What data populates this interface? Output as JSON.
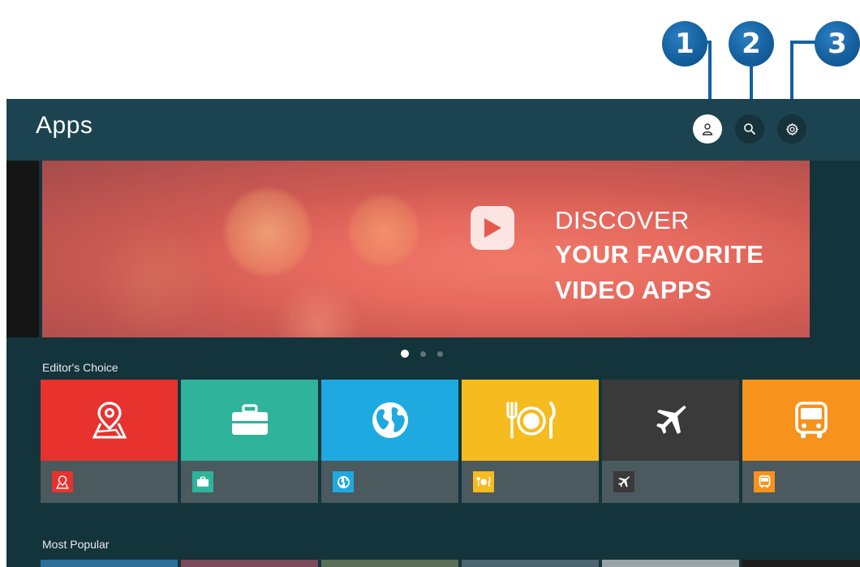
{
  "callouts": [
    "1",
    "2",
    "3"
  ],
  "header": {
    "title": "Apps",
    "buttons": [
      {
        "icon": "person-icon",
        "selected": true
      },
      {
        "icon": "search-icon",
        "selected": false
      },
      {
        "icon": "gear-icon",
        "selected": false
      }
    ]
  },
  "banner": {
    "line1": "DISCOVER",
    "line2": "YOUR FAVORITE",
    "line3": "VIDEO APPS",
    "icon": "play-icon"
  },
  "carousel": {
    "count": 3,
    "active": 0
  },
  "sections": {
    "editors_choice": "Editor's Choice",
    "most_popular": "Most Popular"
  },
  "tiles": [
    {
      "icon": "map-pin-icon",
      "color": "#e8322e"
    },
    {
      "icon": "briefcase-icon",
      "color": "#2fb39b"
    },
    {
      "icon": "globe-icon",
      "color": "#1fa9e1"
    },
    {
      "icon": "dining-icon",
      "color": "#f6bb1e"
    },
    {
      "icon": "airplane-icon",
      "color": "#3a3a3a"
    },
    {
      "icon": "bus-icon",
      "color": "#f7921d"
    }
  ],
  "colors": {
    "header_bg": "#1c4350",
    "content_bg": "#14343c",
    "callout": "#15609f"
  }
}
